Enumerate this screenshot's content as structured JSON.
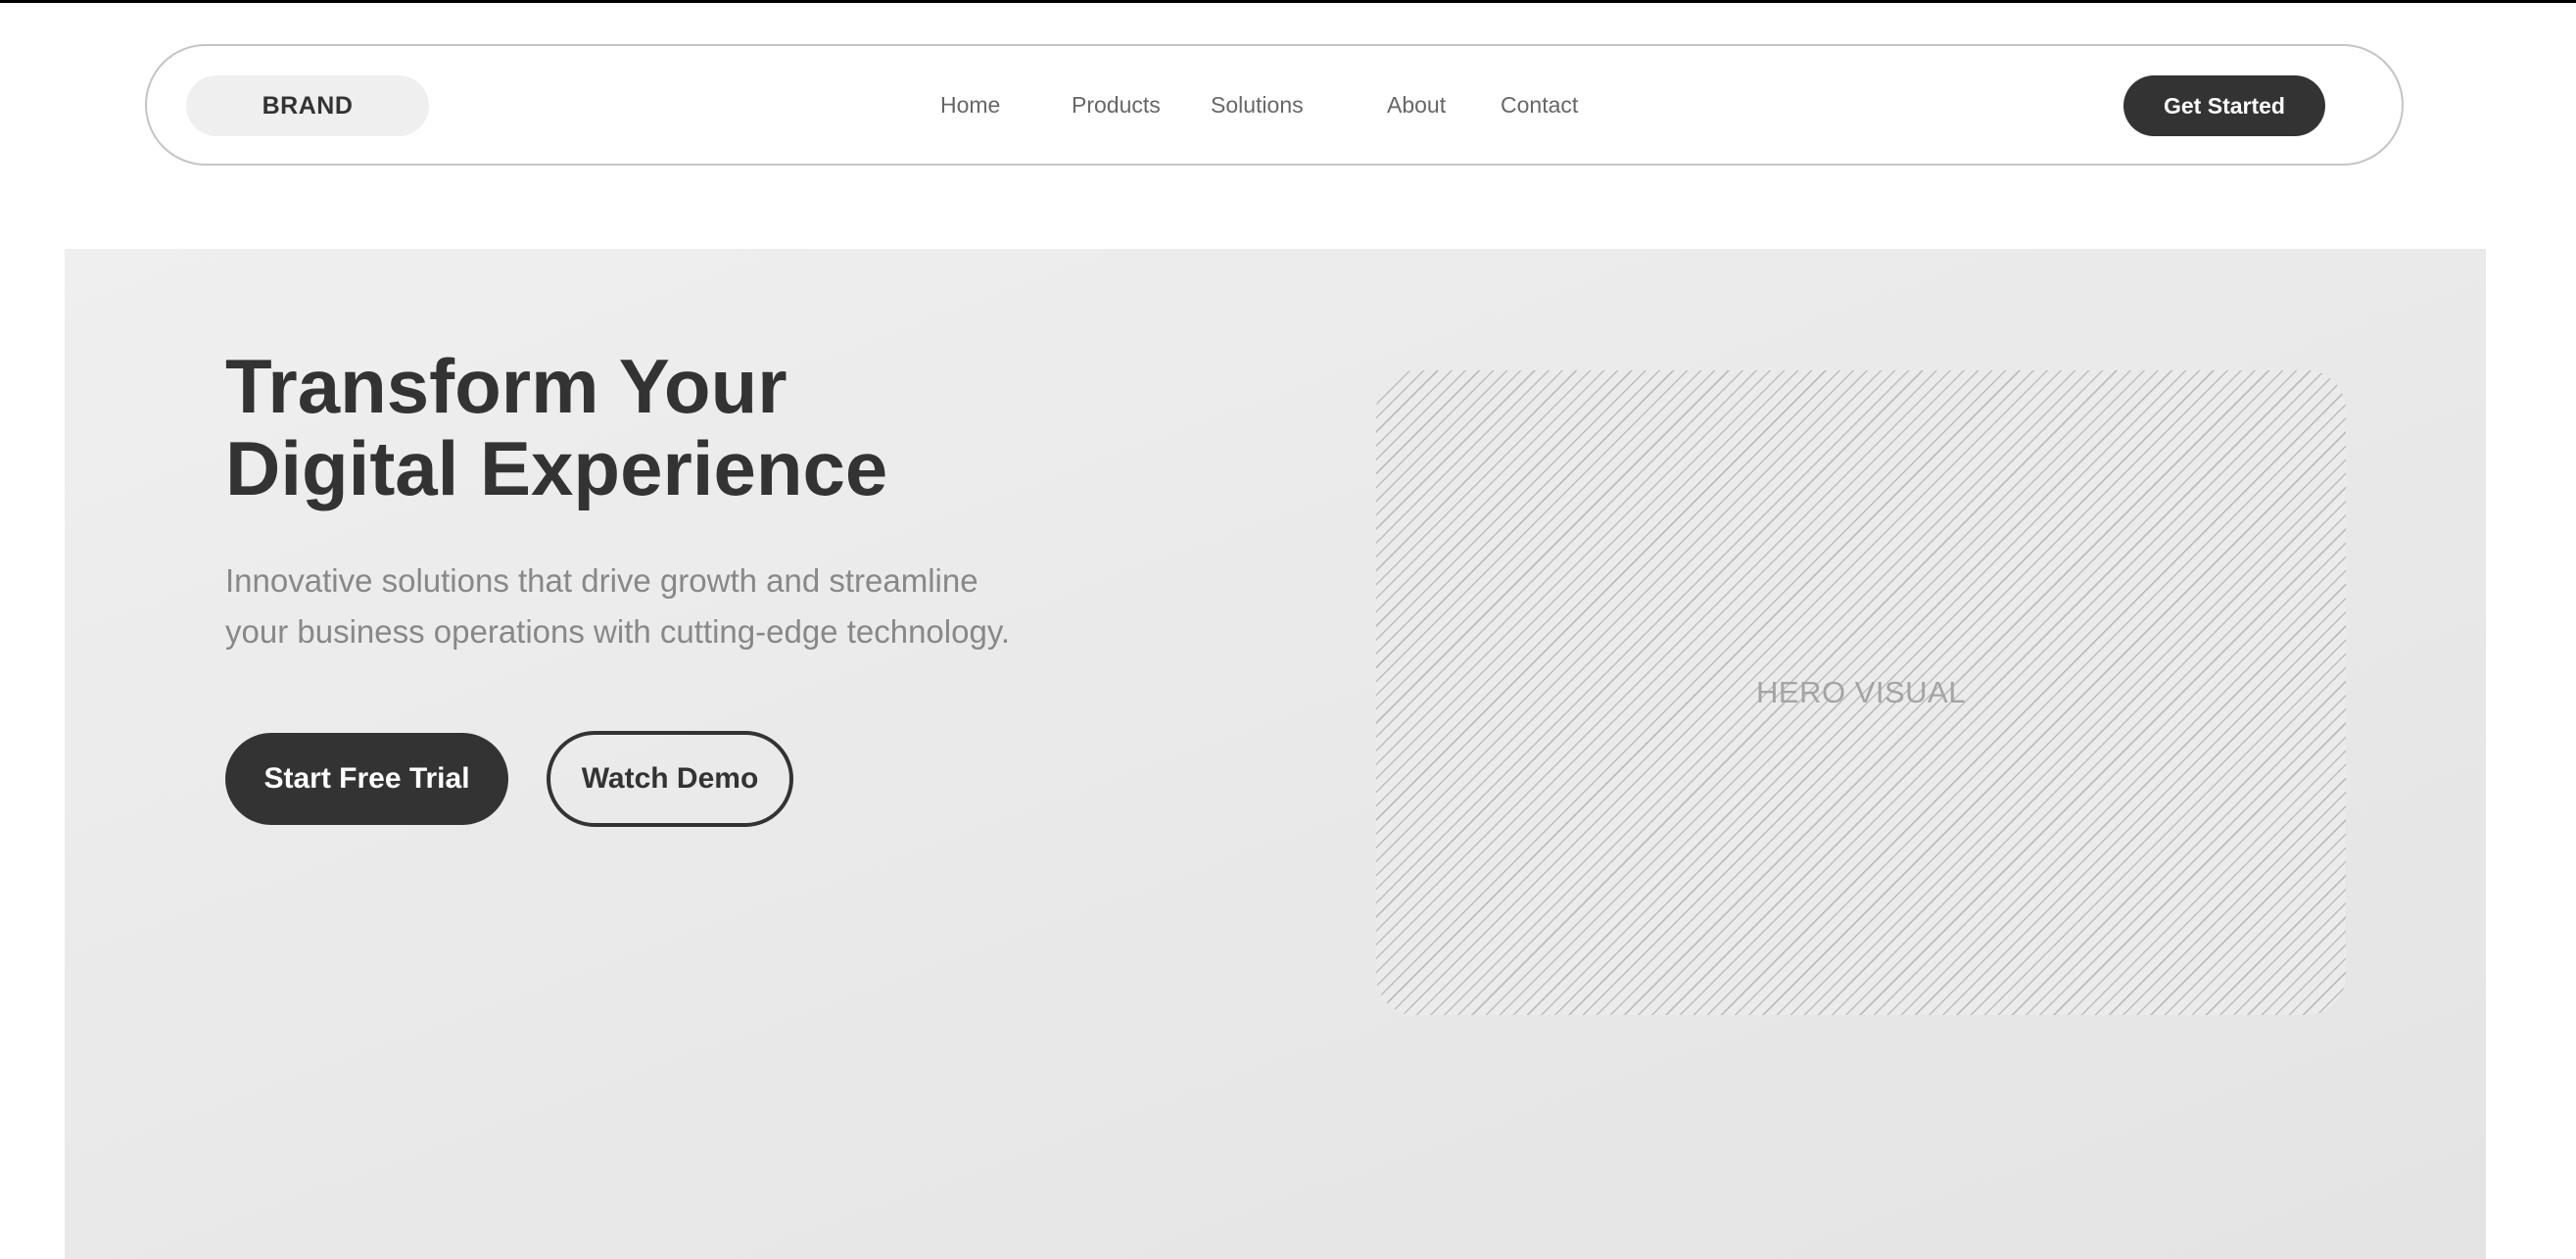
{
  "nav": {
    "brand": "BRAND",
    "links": [
      "Home",
      "Products",
      "Solutions",
      "About",
      "Contact"
    ],
    "cta_label": "Get Started"
  },
  "hero": {
    "title_lines": [
      "Transform Your",
      "Digital Experience"
    ],
    "subtitle_lines": [
      "Innovative solutions that drive growth and streamline",
      "your business operations with cutting-edge technology."
    ],
    "primary_button": "Start Free Trial",
    "secondary_button": "Watch Demo",
    "visual_label": "HERO VISUAL"
  },
  "colors": {
    "text_dark": "#333333",
    "text_muted": "#888888",
    "nav_link": "#666666",
    "hero_background": "#ebebeb",
    "button_dark": "#333333"
  }
}
